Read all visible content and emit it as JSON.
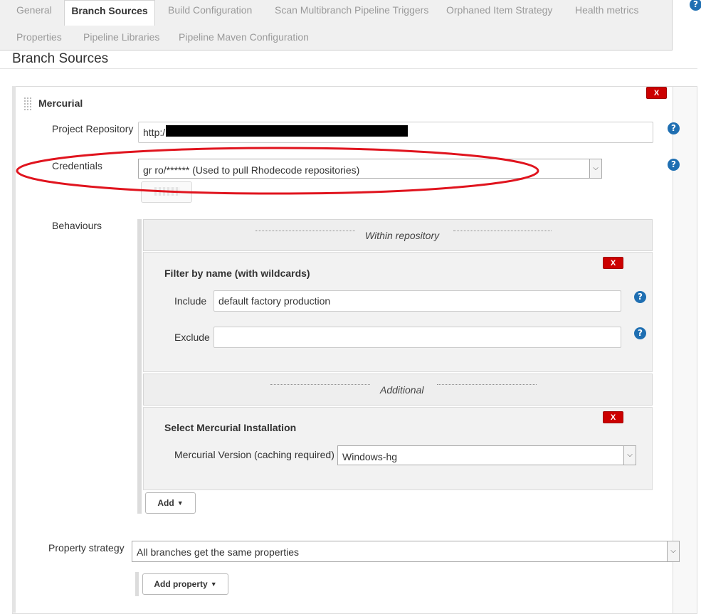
{
  "tabs": [
    {
      "label": "General"
    },
    {
      "label": "Branch Sources"
    },
    {
      "label": "Build Configuration"
    },
    {
      "label": "Scan Multibranch Pipeline Triggers"
    },
    {
      "label": "Orphaned Item Strategy"
    },
    {
      "label": "Health metrics"
    },
    {
      "label": "Properties"
    },
    {
      "label": "Pipeline Libraries"
    },
    {
      "label": "Pipeline Maven Configuration"
    }
  ],
  "active_tab": "Branch Sources",
  "help_label": "?",
  "section": {
    "title": "Branch Sources"
  },
  "source": {
    "title": "Mercurial",
    "delete_label": "X",
    "project_repository": {
      "label": "Project Repository",
      "value": "http:/"
    },
    "credentials": {
      "label": "Credentials",
      "value": "gr  ro/****** (Used to pull Rhodecode repositories)"
    },
    "behaviours": {
      "label": "Behaviours",
      "groups": [
        {
          "heading": "Within repository",
          "items": [
            {
              "title": "Filter by name (with wildcards)",
              "delete_label": "X",
              "fields": [
                {
                  "label": "Include",
                  "value": "default factory production"
                },
                {
                  "label": "Exclude",
                  "value": ""
                }
              ]
            }
          ]
        },
        {
          "heading": "Additional",
          "items": [
            {
              "title": "Select Mercurial Installation",
              "delete_label": "X",
              "fields": [
                {
                  "label": "Mercurial Version (caching required)",
                  "value": "Windows-hg"
                }
              ]
            }
          ]
        }
      ],
      "add_label": "Add"
    },
    "property_strategy": {
      "label": "Property strategy",
      "value": "All branches get the same properties"
    },
    "add_property_label": "Add property"
  },
  "colors": {
    "annotation": "#e0141e",
    "delete": "#cc0000",
    "help": "#1f6fb2"
  }
}
